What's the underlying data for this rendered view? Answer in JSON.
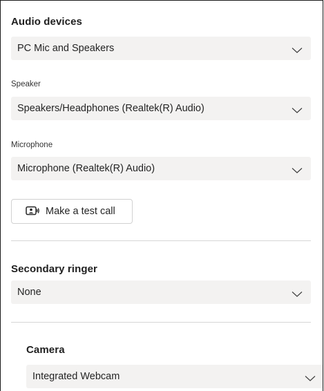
{
  "audio": {
    "title": "Audio devices",
    "device_value": "PC Mic and Speakers",
    "speaker_label": "Speaker",
    "speaker_value": "Speakers/Headphones (Realtek(R) Audio)",
    "microphone_label": "Microphone",
    "microphone_value": "Microphone (Realtek(R) Audio)",
    "test_call_label": "Make a test call",
    "test_call_icon": "test-call-icon"
  },
  "ringer": {
    "title": "Secondary ringer",
    "value": "None"
  },
  "camera": {
    "title": "Camera",
    "value": "Integrated Webcam"
  },
  "colors": {
    "dropdown_bg": "#f3f2f1",
    "text": "#242424",
    "divider": "#d6d6d6"
  }
}
